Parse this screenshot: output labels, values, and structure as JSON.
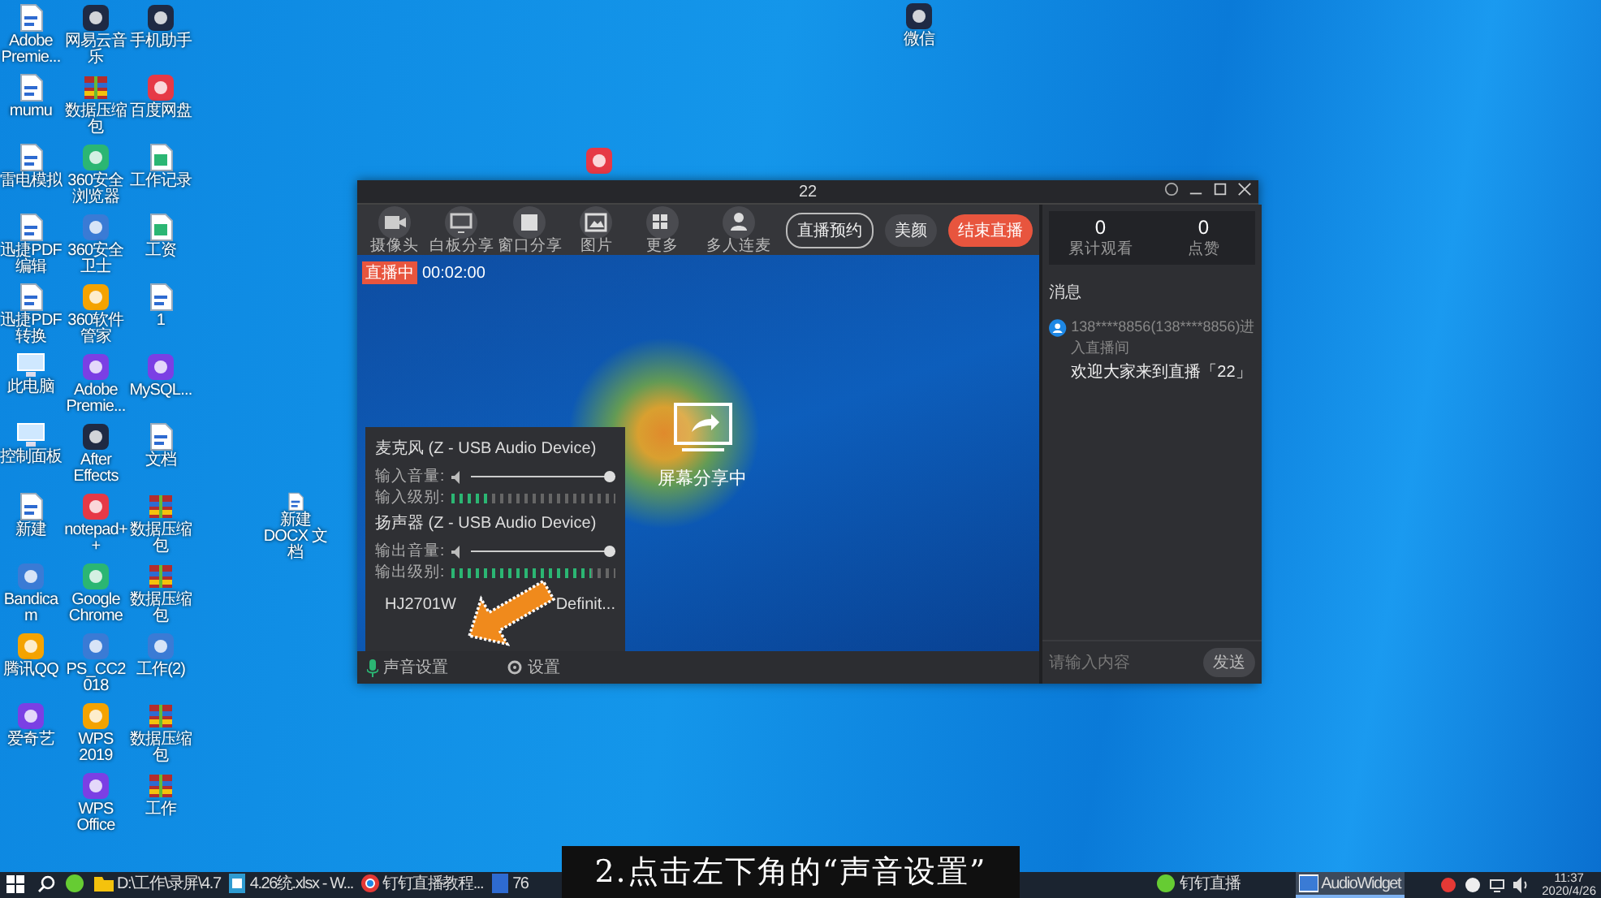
{
  "desktop": {
    "columns": [
      [
        {
          "kind": "doc",
          "label": "Adobe Premie..."
        },
        {
          "kind": "doc",
          "label": "mumu"
        },
        {
          "kind": "doc",
          "label": "雷电模拟"
        },
        {
          "kind": "doc",
          "label": "迅捷PDF编辑"
        },
        {
          "kind": "doc",
          "label": "迅捷PDF转换"
        },
        {
          "kind": "pc",
          "label": "此电脑"
        },
        {
          "kind": "pc",
          "label": "控制面板"
        },
        {
          "kind": "doc",
          "label": "新建"
        },
        {
          "kind": "app",
          "label": "Bandicam"
        },
        {
          "kind": "app",
          "label": "腾讯QQ"
        },
        {
          "kind": "app",
          "label": "爱奇艺"
        }
      ],
      [
        {
          "kind": "app",
          "label": "网易云音乐"
        },
        {
          "kind": "archive",
          "label": "数据压缩包"
        },
        {
          "kind": "app",
          "label": "360安全浏览器"
        },
        {
          "kind": "app",
          "label": "360安全卫士"
        },
        {
          "kind": "app",
          "label": "360软件管家"
        },
        {
          "kind": "app",
          "label": "Adobe Premie..."
        },
        {
          "kind": "app",
          "label": "After Effects"
        },
        {
          "kind": "app",
          "label": "notepad++"
        },
        {
          "kind": "app",
          "label": "Google Chrome"
        },
        {
          "kind": "app",
          "label": "PS_CC2018"
        },
        {
          "kind": "app",
          "label": "WPS 2019"
        },
        {
          "kind": "app",
          "label": "WPS Office"
        }
      ],
      [
        {
          "kind": "app",
          "label": "手机助手"
        },
        {
          "kind": "app",
          "label": "百度网盘"
        },
        {
          "kind": "sheet",
          "label": "工作记录"
        },
        {
          "kind": "sheet",
          "label": "工资"
        },
        {
          "kind": "doc",
          "label": "1"
        },
        {
          "kind": "app",
          "label": "MySQL..."
        },
        {
          "kind": "doc",
          "label": "文档"
        },
        {
          "kind": "archive",
          "label": "数据压缩包"
        },
        {
          "kind": "archive",
          "label": "数据压缩包"
        },
        {
          "kind": "app",
          "label": "工作(2)"
        },
        {
          "kind": "archive",
          "label": "数据压缩包"
        },
        {
          "kind": "archive",
          "label": "工作"
        }
      ]
    ],
    "loose_icons": [
      {
        "kind": "app",
        "label": "微信"
      },
      {
        "kind": "app"
      },
      {
        "kind": "doc",
        "label": "新建 DOCX 文档"
      }
    ]
  },
  "app_window": {
    "title": "22",
    "toolbar": [
      {
        "kind": "camera",
        "label": "摄像头"
      },
      {
        "kind": "board",
        "label": "白板分享"
      },
      {
        "kind": "window",
        "label": "窗口分享"
      },
      {
        "kind": "image",
        "label": "图片"
      },
      {
        "kind": "grid",
        "label": "更多"
      },
      {
        "kind": "person",
        "label": "多人连麦"
      }
    ],
    "actions": [
      {
        "kind": "outline",
        "label": "直播预约"
      },
      {
        "kind": "plain",
        "label": "美颜"
      },
      {
        "kind": "primary",
        "label": "结束直播"
      }
    ],
    "live_badge": "直播中",
    "live_timer": "00:02:00",
    "share_status": "屏幕分享中",
    "audio_panel": {
      "devices": [
        {
          "name_parts": [
            "麦克风 (Z - USB Audio Device)"
          ],
          "rows": [
            {
              "kind": "slider",
              "label": "输入音量:",
              "level": 1.0
            },
            {
              "kind": "meter",
              "label": "输入级别:",
              "level": 0.25
            }
          ]
        },
        {
          "name_parts": [
            "扬声器 (Z - USB Audio Device)"
          ],
          "rows": [
            {
              "kind": "slider",
              "label": "输出音量:",
              "level": 1.0
            },
            {
              "kind": "meter",
              "label": "输出级别:",
              "level": 0.85
            }
          ]
        },
        {
          "name_parts": [
            "HJ2701W",
            "Definit..."
          ]
        }
      ]
    },
    "bottom_bar": [
      {
        "kind": "mic",
        "label": "声音设置"
      },
      {
        "kind": "gear",
        "label": "设置"
      }
    ],
    "stats": [
      {
        "value": "0",
        "label": "累计观看"
      },
      {
        "value": "0",
        "label": "点赞"
      }
    ],
    "messages_title": "消息",
    "messages": [
      {
        "sender": "138****8856(138****8856)进入直播间",
        "text": "欢迎大家来到直播「22」"
      }
    ],
    "input": {
      "placeholder": "请输入内容"
    },
    "send_button": "发送"
  },
  "taskbar": {
    "left": [
      {
        "kind": "app",
        "selected": false
      },
      {
        "kind": "folder",
        "label": "D:\\工作\\录屏\\4.7",
        "selected": false
      },
      {
        "kind": "sheet",
        "label": "4.26统.xlsx - W...",
        "selected": false
      },
      {
        "kind": "browser",
        "label": "钉钉直播教程...",
        "selected": false
      },
      {
        "kind": "doc",
        "label": "76",
        "selected": false
      }
    ],
    "right": [
      {
        "kind": "app",
        "label": "钉钉直播",
        "selected": false
      },
      {
        "kind": "window",
        "label": "AudioWidget",
        "selected": true
      }
    ],
    "clock": {
      "time": "11:37",
      "date": "2020/4/26"
    }
  },
  "caption": "2.点击左下角的“声音设置”"
}
